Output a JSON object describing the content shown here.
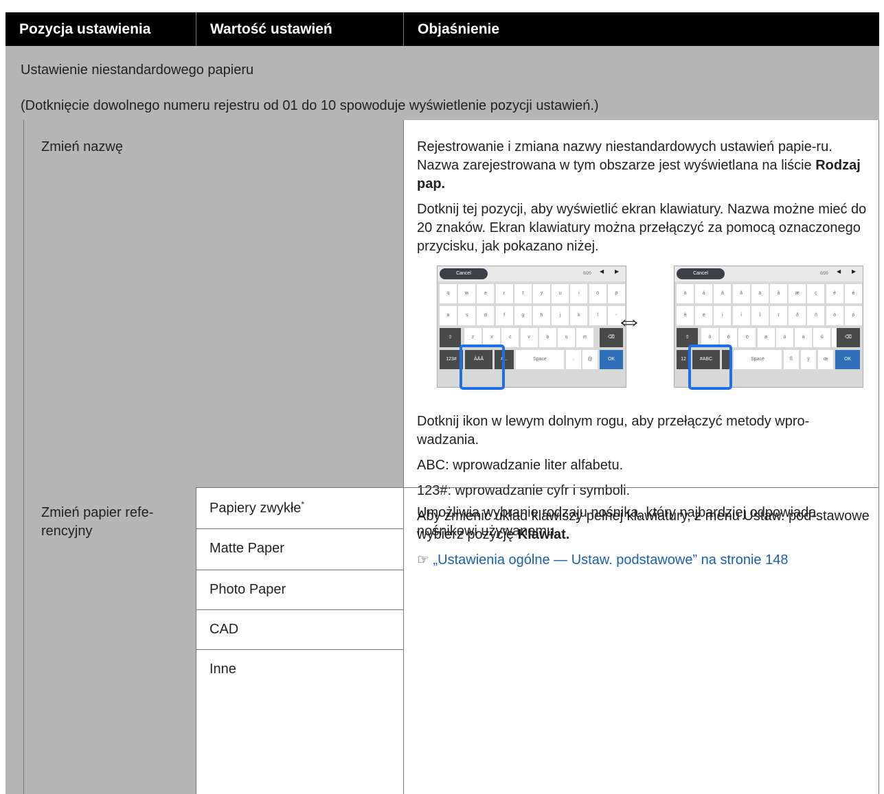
{
  "header": {
    "col1": "Pozycja ustawienia",
    "col2": "Wartość ustawień",
    "col3": "Objaśnienie"
  },
  "section": {
    "title": "Ustawienie niestandardowego papieru",
    "note": "(Dotknięcie dowolnego numeru rejestru od 01 do 10 spowoduje wyświetlenie pozycji ustawień.)"
  },
  "rename": {
    "label": "Zmień nazwę",
    "p1_text": "Rejestrowanie i zmiana nazwy niestandardowych ustawień papie-ru. Nazwa zarejestrowana w tym obszarze jest wyświetlana na liście",
    "p1_bold": "Rodzaj pap.",
    "p2": "Dotknij tej pozycji, aby wyświetlić ekran klawiatury. Nazwa możne mieć do 20 znaków. Ekran klawiatury można przełączyć za pomocą oznaczonego przycisku, jak pokazano niżej.",
    "p3": "Dotknij ikon w lewym dolnym rogu, aby przełączyć metody wpro-wadzania.",
    "p4": "ABC: wprowadzanie liter alfabetu.",
    "p5": "123#: wprowadzanie cyfr i symboli.",
    "p6_text": "Aby zmienić układ klawiszy pełnej klawiatury, z menu Ustaw. pod-stawowe wybierz pozycję",
    "p6_bold": "Klawiat.",
    "link": "„Ustawienia ogólne — Ustaw. podstawowe” na stronie 148",
    "link_icon": "hand-pointing-icon"
  },
  "keyboard": {
    "cancel": "Cancel",
    "counter": "0/20",
    "space": "Space",
    "ok": "OK",
    "left_row1": [
      "q",
      "w",
      "e",
      "r",
      "t",
      "y",
      "u",
      "i",
      "o",
      "p"
    ],
    "left_row2": [
      "a",
      "s",
      "d",
      "f",
      "g",
      "h",
      "j",
      "k",
      "l",
      "-"
    ],
    "left_row3": [
      "z",
      "x",
      "c",
      "v",
      "b",
      "n",
      "m"
    ],
    "left_mode1": "123#",
    "left_mode2": "ÀÄÅ",
    "left_sym": "#...",
    "left_dot": ".",
    "left_at": "@",
    "right_row1": [
      "à",
      "á",
      "â",
      "ã",
      "ä",
      "å",
      "æ",
      "ç",
      "è",
      "é"
    ],
    "right_row2": [
      "ê",
      "ë",
      "ì",
      "í",
      "î",
      "ï",
      "ð",
      "ñ",
      "ò",
      "ó"
    ],
    "right_row3": [
      "ô",
      "õ",
      "ö",
      "ø",
      "ù",
      "ú",
      "û",
      "ü"
    ],
    "right_mode1": "12",
    "right_mode2": "#ABC",
    "right_extra": [
      "ß",
      "ÿ",
      "œ"
    ]
  },
  "reference": {
    "label": "Zmień papier refe-rencyjny",
    "options": [
      "Papiery zwykłe",
      "Matte Paper",
      "Photo Paper",
      "CAD",
      "Inne"
    ],
    "option1_mark": "*",
    "desc": "Umożliwia wybranie rodzaju nośnika, który najbardziej odpowiada nośnikowi używanemu."
  }
}
